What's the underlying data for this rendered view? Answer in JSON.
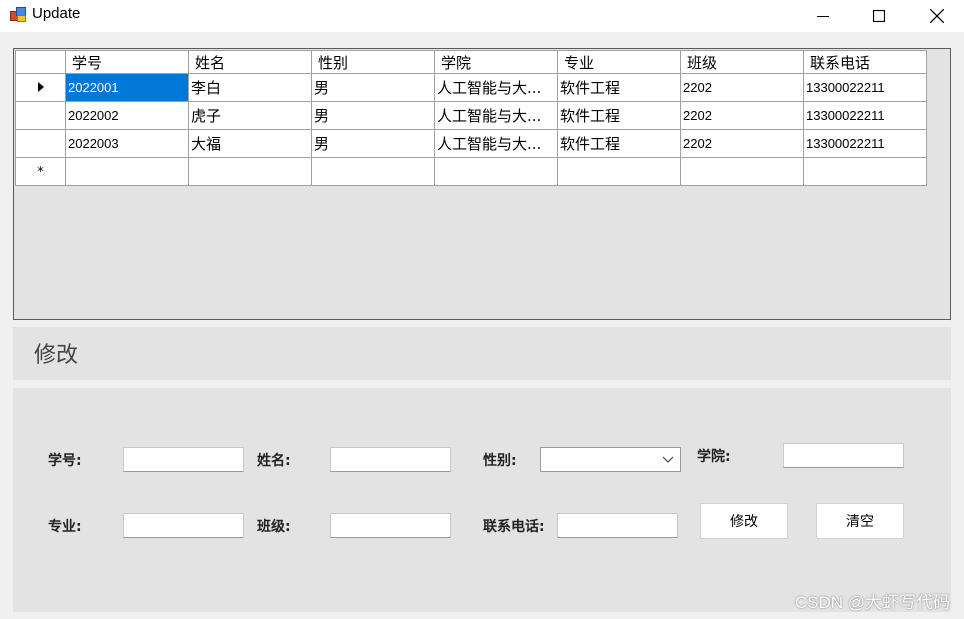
{
  "window": {
    "title": "Update",
    "icon": "app-icon",
    "controls": [
      "minimize-icon",
      "maximize-icon",
      "close-icon"
    ]
  },
  "grid": {
    "columns": [
      "学号",
      "姓名",
      "性别",
      "学院",
      "专业",
      "班级",
      "联系电话"
    ],
    "rows": [
      [
        "2022001",
        "李白",
        "男",
        "人工智能与大...",
        "软件工程",
        "2202",
        "13300022211"
      ],
      [
        "2022002",
        "虎子",
        "男",
        "人工智能与大...",
        "软件工程",
        "2202",
        "13300022211"
      ],
      [
        "2022003",
        "大福",
        "男",
        "人工智能与大...",
        "软件工程",
        "2202",
        "13300022211"
      ]
    ],
    "selected_cell": {
      "row": 0,
      "col": 0
    },
    "selection_color": "#0078d7"
  },
  "edit": {
    "heading": "修改",
    "labels": {
      "id": "学号:",
      "name": "姓名:",
      "gender": "性别:",
      "college": "学院:",
      "major": "专业:",
      "class": "班级:",
      "phone": "联系电话:"
    },
    "values": {
      "id": "",
      "name": "",
      "gender": "",
      "college": "",
      "major": "",
      "class": "",
      "phone": ""
    },
    "buttons": {
      "update": "修改",
      "clear": "清空"
    }
  },
  "watermark": "CSDN @大虾写代码"
}
